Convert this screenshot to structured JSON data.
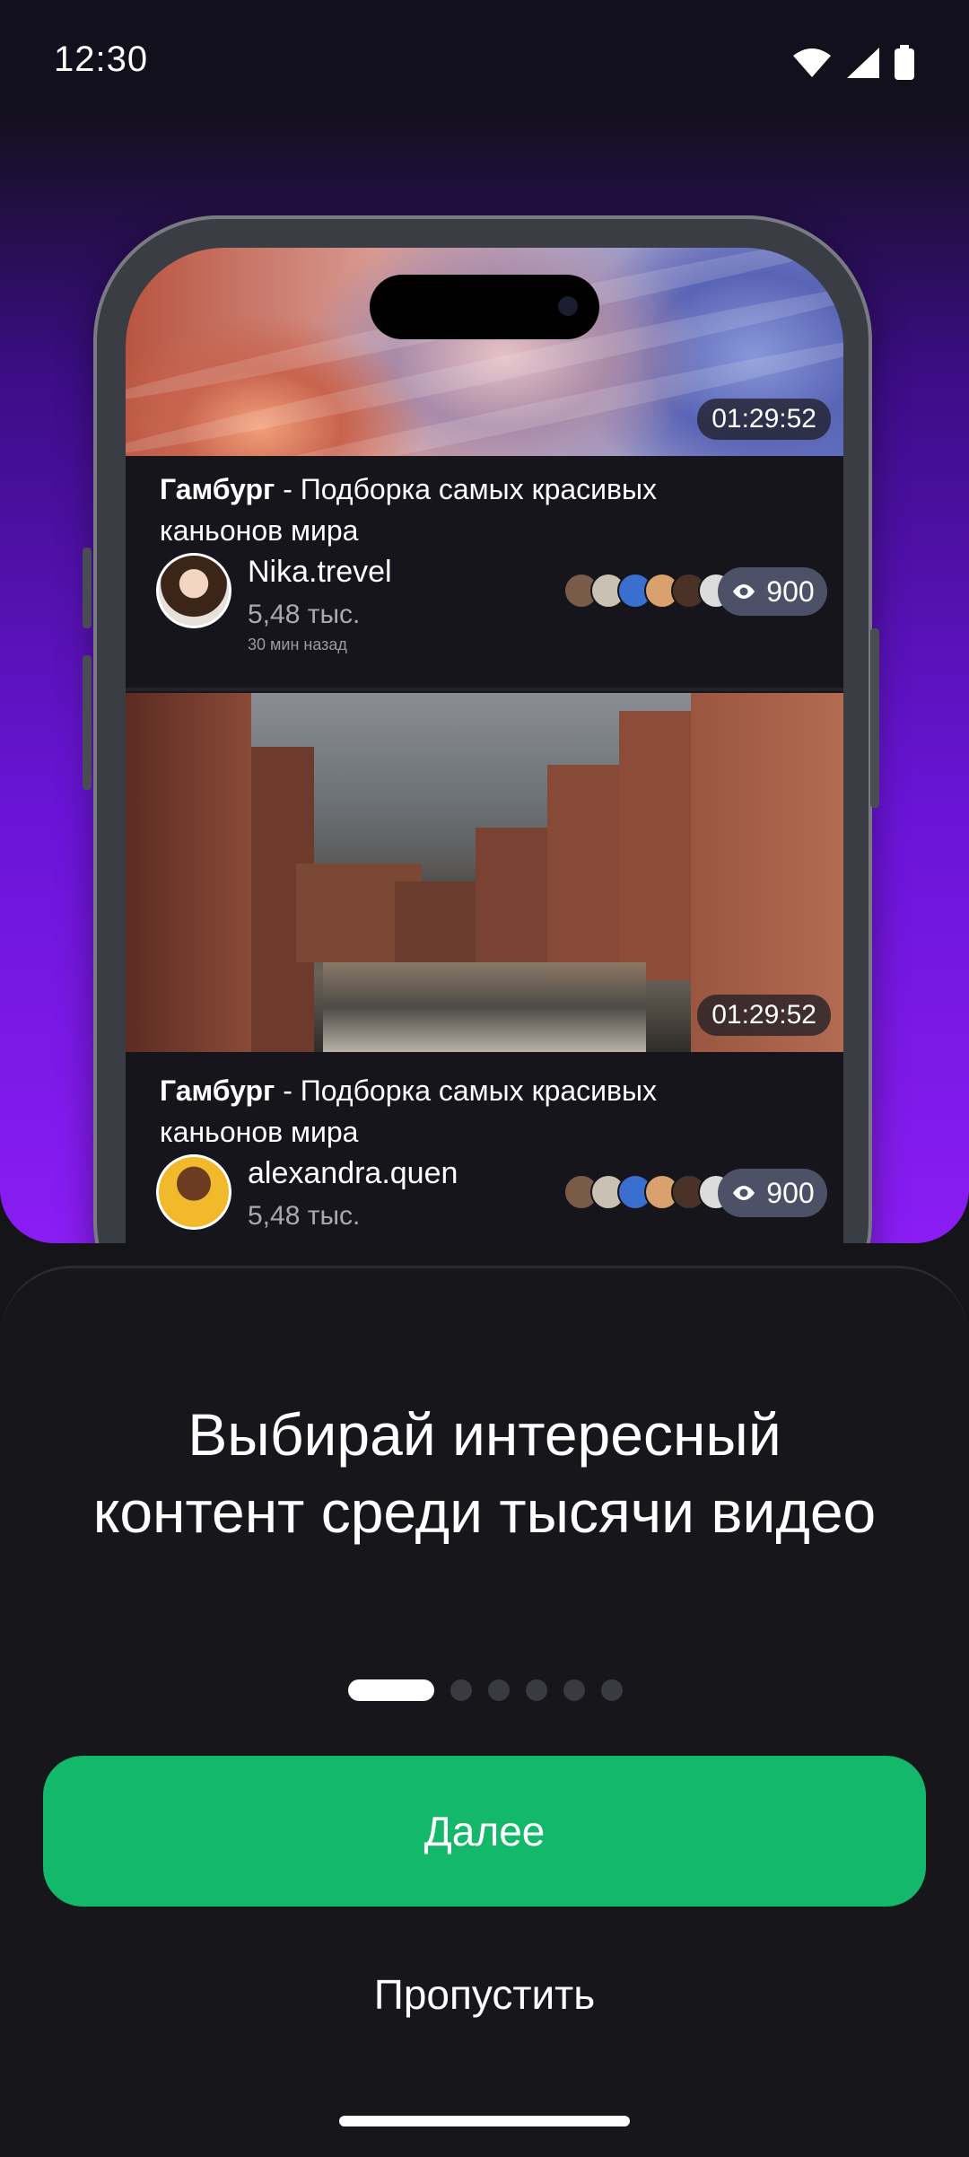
{
  "status_bar": {
    "time": "12:30"
  },
  "preview": {
    "cards": [
      {
        "duration": "01:29:52",
        "title_bold": "Гамбург",
        "title_rest": " - Подборка самых красивых каньонов мира",
        "author": "Nika.trevel",
        "followers": "5,48 тыс.",
        "time_ago": "30 мин назад",
        "views": "900"
      },
      {
        "duration": "01:29:52",
        "title_bold": "Гамбург",
        "title_rest": " - Подборка самых красивых каньонов мира",
        "author": "alexandra.quen",
        "followers": "5,48 тыс.",
        "views": "900"
      }
    ]
  },
  "onboarding": {
    "headline_line1": "Выбирай интересный",
    "headline_line2": "контент среди тысячи видео",
    "page_indicator": {
      "total": 6,
      "active": 1
    },
    "next_label": "Далее",
    "skip_label": "Пропустить"
  },
  "colors": {
    "accent_green": "#14b86b",
    "hero_purple": "#8a1df4",
    "sheet_bg": "#16161b"
  }
}
